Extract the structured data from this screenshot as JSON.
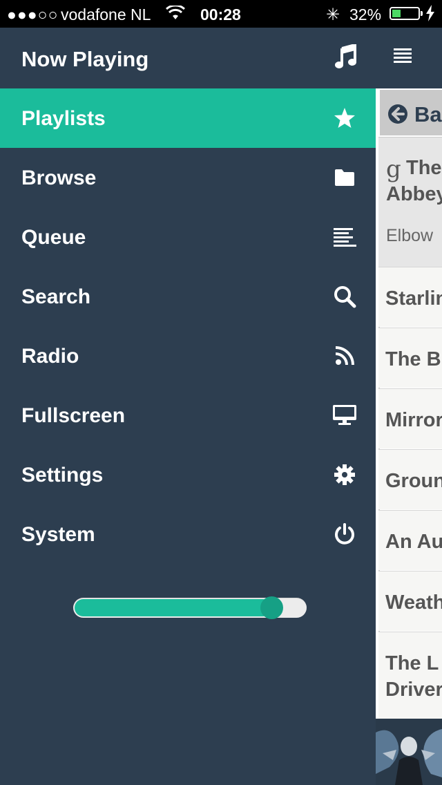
{
  "status_bar": {
    "signal": "●●●○○",
    "carrier": "vodafone NL",
    "time": "00:28",
    "battery_percent": "32%",
    "battery_level": 0.32,
    "icons": [
      "wifi-icon",
      "activity-spinner-icon",
      "battery-icon",
      "charging-bolt-icon"
    ]
  },
  "header": {
    "title": "Now Playing",
    "icons": [
      "music-note-icon",
      "menu-icon"
    ]
  },
  "menu": {
    "items": [
      {
        "label": "Playlists",
        "icon": "star-icon",
        "active": true
      },
      {
        "label": "Browse",
        "icon": "folder-icon",
        "active": false
      },
      {
        "label": "Queue",
        "icon": "queue-list-icon",
        "active": false
      },
      {
        "label": "Search",
        "icon": "search-icon",
        "active": false
      },
      {
        "label": "Radio",
        "icon": "rss-icon",
        "active": false
      },
      {
        "label": "Fullscreen",
        "icon": "monitor-icon",
        "active": false
      },
      {
        "label": "Settings",
        "icon": "gear-icon",
        "active": false
      },
      {
        "label": "System",
        "icon": "power-icon",
        "active": false
      }
    ]
  },
  "volume": {
    "level": 0.85
  },
  "colors": {
    "background": "#2d3e50",
    "accent": "#1bbc9b",
    "knob": "#16a085"
  },
  "content": {
    "back_label": "Ba",
    "album_title_line1": "The",
    "album_title_line2": "Abbey",
    "album_artist": "Elbow",
    "tracks": [
      "Starlin",
      "The B",
      "Mirror",
      "Groun",
      "An Au",
      "Weath"
    ],
    "last_track_line1": "The L",
    "last_track_line2": "Driver"
  }
}
